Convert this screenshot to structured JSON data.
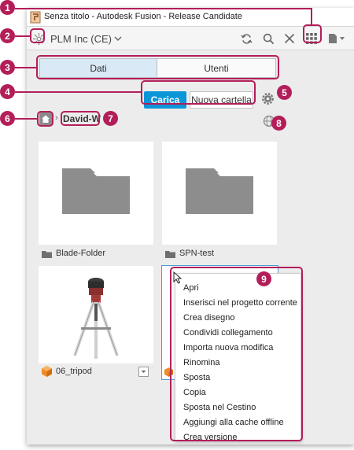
{
  "window": {
    "title": "Senza titolo - Autodesk Fusion - Release Candidate"
  },
  "header": {
    "hub_name": "PLM Inc (CE)"
  },
  "tabs": [
    {
      "label": "Dati",
      "active": true
    },
    {
      "label": "Utenti",
      "active": false
    }
  ],
  "toolbar": {
    "upload_label": "Carica",
    "new_folder_label": "Nuova cartella"
  },
  "breadcrumb": {
    "separator": "›",
    "current": "David-W"
  },
  "items": [
    {
      "name": "Blade-Folder",
      "type": "folder"
    },
    {
      "name": "SPN-test",
      "type": "folder"
    },
    {
      "name": "06_tripod",
      "type": "design"
    }
  ],
  "context_menu": {
    "items": [
      "Apri",
      "Inserisci nel progetto corrente",
      "Crea disegno",
      "Condividi collegamento",
      "Importa nuova modifica",
      "Rinomina",
      "Sposta",
      "Copia",
      "Sposta nel Cestino",
      "Aggiungi alla cache offline",
      "Crea versione"
    ]
  },
  "callouts": [
    "1",
    "2",
    "3",
    "4",
    "5",
    "6",
    "7",
    "8",
    "9"
  ],
  "colors": {
    "accent": "#0b96d8",
    "callout": "#b31e59",
    "active_tab": "#d9e9f6",
    "design_icon": "#f08a24"
  }
}
